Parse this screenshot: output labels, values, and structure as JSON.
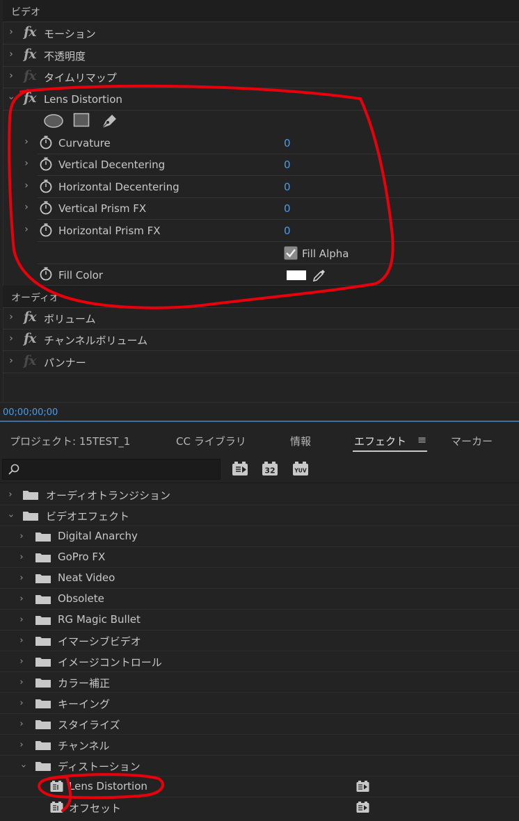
{
  "effect_controls": {
    "video_header": "ビデオ",
    "video_effects": [
      {
        "label": "モーション",
        "enabled": true
      },
      {
        "label": "不透明度",
        "enabled": true
      },
      {
        "label": "タイムリマップ",
        "enabled": false
      }
    ],
    "lens_distortion": {
      "label": "Lens Distortion",
      "params": [
        {
          "name": "Curvature",
          "value": "0"
        },
        {
          "name": "Vertical Decentering",
          "value": "0"
        },
        {
          "name": "Horizontal Decentering",
          "value": "0"
        },
        {
          "name": "Vertical Prism FX",
          "value": "0"
        },
        {
          "name": "Horizontal Prism FX",
          "value": "0"
        }
      ],
      "fill_alpha_label": "Fill Alpha",
      "fill_alpha_checked": true,
      "fill_color_label": "Fill Color",
      "fill_color_value": "#ffffff"
    },
    "audio_header": "オーディオ",
    "audio_effects": [
      {
        "label": "ボリューム",
        "enabled": true
      },
      {
        "label": "チャンネルボリューム",
        "enabled": true
      },
      {
        "label": "パンナー",
        "enabled": false
      }
    ],
    "timecode": "00;00;00;00"
  },
  "panel_tabs": {
    "project": "プロジェクト: 15TEST_1",
    "cc_libraries": "CC ライブラリ",
    "info": "情報",
    "effects": "エフェクト",
    "markers": "マーカー"
  },
  "effects_panel": {
    "search_placeholder": "",
    "toolbar_icons": [
      "accelerated-effects-icon",
      "32-bit-color-icon",
      "yuv-effects-icon"
    ],
    "toolbar_32_text": "32",
    "toolbar_yuv_text": "YUV",
    "tree": {
      "audio_transitions": "オーディオトランジション",
      "video_effects": "ビデオエフェクト",
      "video_effect_folders": [
        "Digital Anarchy",
        "GoPro FX",
        "Neat Video",
        "Obsolete",
        "RG Magic Bullet",
        "イマーシブビデオ",
        "イメージコントロール",
        "カラー補正",
        "キーイング",
        "スタイライズ",
        "チャンネル"
      ],
      "distortion_folder": "ディストーション",
      "distortion_items": [
        "Lens Distortion",
        "オフセット"
      ]
    }
  },
  "colors": {
    "panel_bg": "#232323",
    "accent_blue": "#4a9ce8",
    "annotation_red": "#e8000b"
  }
}
